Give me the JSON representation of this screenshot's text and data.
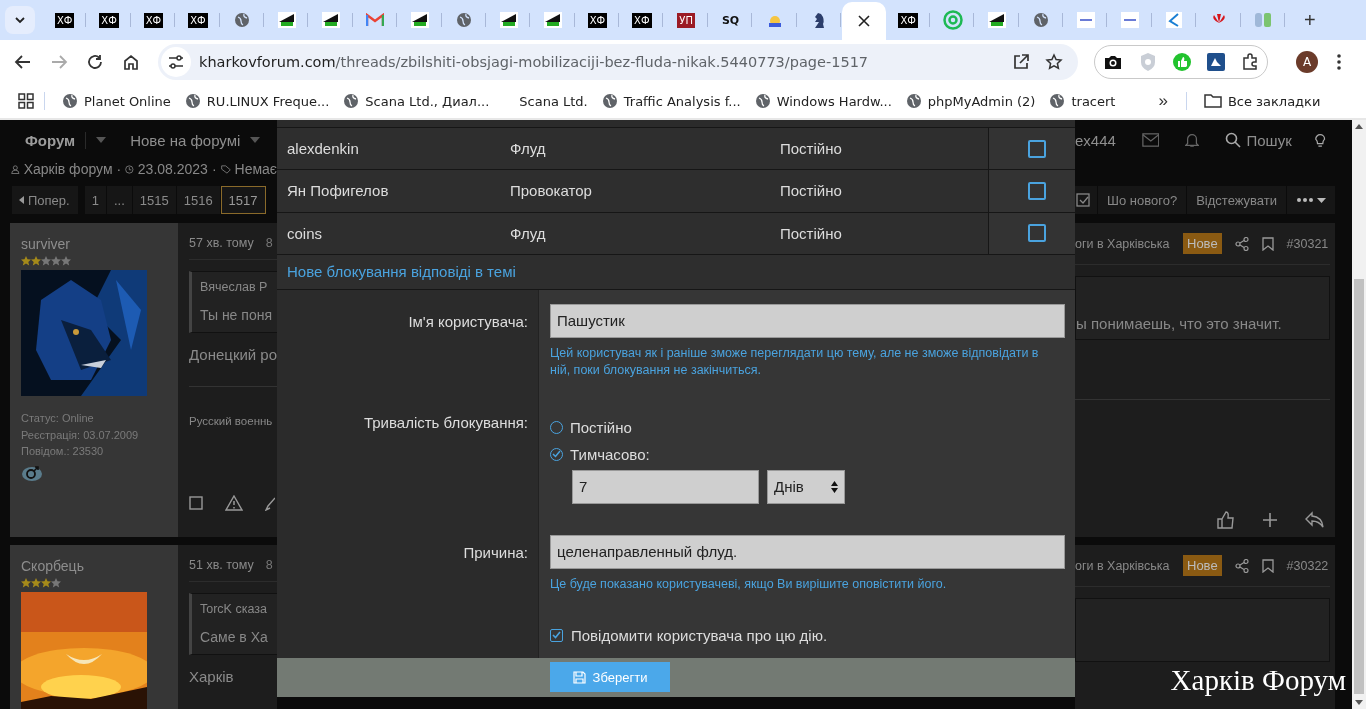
{
  "browser": {
    "tabs": [
      {
        "kind": "text",
        "text": "ХФ",
        "selected": false
      },
      {
        "kind": "text",
        "text": "ХФ",
        "selected": false
      },
      {
        "kind": "text",
        "text": "ХФ",
        "selected": false
      },
      {
        "kind": "text",
        "text": "ХФ",
        "selected": false
      },
      {
        "kind": "globe",
        "selected": false
      },
      {
        "kind": "mobile",
        "selected": false
      },
      {
        "kind": "mobile",
        "selected": false
      },
      {
        "kind": "mail",
        "selected": false
      },
      {
        "kind": "mobile",
        "selected": false
      },
      {
        "kind": "globe",
        "selected": false
      },
      {
        "kind": "mobile",
        "selected": false
      },
      {
        "kind": "mobile",
        "selected": false
      },
      {
        "kind": "text",
        "text": "ХФ",
        "selected": false
      },
      {
        "kind": "text",
        "text": "ХФ",
        "selected": false
      },
      {
        "kind": "redtext",
        "text": "УП",
        "selected": false
      },
      {
        "kind": "plaintext",
        "text": "SQ",
        "selected": false
      },
      {
        "kind": "sun",
        "selected": false
      },
      {
        "kind": "chess",
        "selected": false
      },
      {
        "kind": "page",
        "selected": true
      },
      {
        "kind": "text",
        "text": "ХФ",
        "selected": false
      },
      {
        "kind": "ring",
        "selected": false
      },
      {
        "kind": "mobile",
        "selected": false
      },
      {
        "kind": "globe",
        "selected": false
      },
      {
        "kind": "lyng",
        "selected": false
      },
      {
        "kind": "lyng",
        "selected": false
      },
      {
        "kind": "swoosh",
        "selected": false
      },
      {
        "kind": "flower",
        "selected": false
      },
      {
        "kind": "bars",
        "selected": false
      }
    ],
    "new_tab": "+",
    "url": {
      "host": "kharkovforum.com",
      "path": "/threads/zbilshiti-obsjagi-mobilizaciji-bez-fluda-nikak.5440773/page-1517"
    },
    "profile": "A",
    "bookmarks": [
      {
        "label": "Planet Online",
        "globe": true
      },
      {
        "label": "RU.LINUX Freque...",
        "globe": true
      },
      {
        "label": "Scana Ltd., Диал...",
        "globe": true
      },
      {
        "label": "Scana Ltd.",
        "globe": false
      },
      {
        "label": "Traffic Analysis f...",
        "globe": true
      },
      {
        "label": "Windows Hardw...",
        "globe": true
      },
      {
        "label": "phpMyAdmin (2)",
        "globe": true
      },
      {
        "label": "tracert",
        "globe": true
      }
    ],
    "more": "»",
    "all_bookmarks": "Все закладки"
  },
  "forum": {
    "nav": [
      "Форум",
      "Нове на форумі"
    ],
    "meta": {
      "author": "Харків форум",
      "separator": "·",
      "date": "23.08.2023",
      "tags": "Немає"
    },
    "pager": {
      "prev": "Попер.",
      "pages": [
        {
          "label": "1",
          "selected": false
        },
        {
          "label": "...",
          "selected": false
        },
        {
          "label": "1515",
          "selected": false
        },
        {
          "label": "1516",
          "selected": false
        },
        {
          "label": "1517",
          "selected": true
        }
      ]
    },
    "user": "ex444",
    "search": "Пошук",
    "actions": [
      "Шо нового?",
      "Відстежувати"
    ],
    "posts": [
      {
        "author": "surviver",
        "star_filled": [
          true,
          true,
          false,
          false,
          false
        ],
        "select_checked": false,
        "stats": [
          "Статус: Online",
          "Реєстрація: 03.07.2009",
          "Повідом.: 23530"
        ],
        "time": "57 хв. тому",
        "time_tail": "8",
        "quote_author": "Вячеслав Р",
        "quote_left": "Ты не поня",
        "quote_right": "ы понимаешь, что это значит.",
        "body": "Донецкий ро",
        "signature": "Русский военнь",
        "title": "оги в Харківська",
        "badge": "Нове",
        "number": "#30321"
      },
      {
        "author": "Скорбець",
        "star_filled": [
          true,
          true,
          true,
          false
        ],
        "time": "51 хв. тому",
        "time_tail": "8",
        "quote_author": "TorcK сказа",
        "quote_left": "Саме в Ха",
        "body": "Харків",
        "title": "оги в Харківська",
        "badge": "Нове",
        "number": "#30322"
      }
    ],
    "logo": "Харків Форум"
  },
  "modal": {
    "bans": [
      {
        "user": "alexdenkin",
        "reason": "Флуд",
        "duration": "Постійно",
        "checked": false
      },
      {
        "user": "Ян Пофигелов",
        "reason": "Провокатор",
        "duration": "Постійно",
        "checked": false
      },
      {
        "user": "coins",
        "reason": "Флуд",
        "duration": "Постійно",
        "checked": false
      }
    ],
    "new_ban": "Нове блокування відповіді в темі",
    "username": {
      "label": "Ім'я користувача:",
      "value": "Пашустик",
      "hint": "Цей користувач як і раніше зможе переглядати цю тему, але не зможе відповідати в ній, поки блокування не закінчиться."
    },
    "duration": {
      "label": "Тривалість блокування:",
      "options": [
        {
          "label": "Постійно",
          "selected": false
        },
        {
          "label": "Тимчасово:",
          "selected": true
        }
      ],
      "amount": "7",
      "unit": "Днів"
    },
    "reason": {
      "label": "Причина:",
      "value": "целенаправленный флуд.",
      "hint": "Це буде показано користувачеві, якщо Ви вирішите оповістити його."
    },
    "notify": {
      "label": "Повідомити користувача про цю дію.",
      "checked": true
    },
    "save": "Зберегти"
  }
}
